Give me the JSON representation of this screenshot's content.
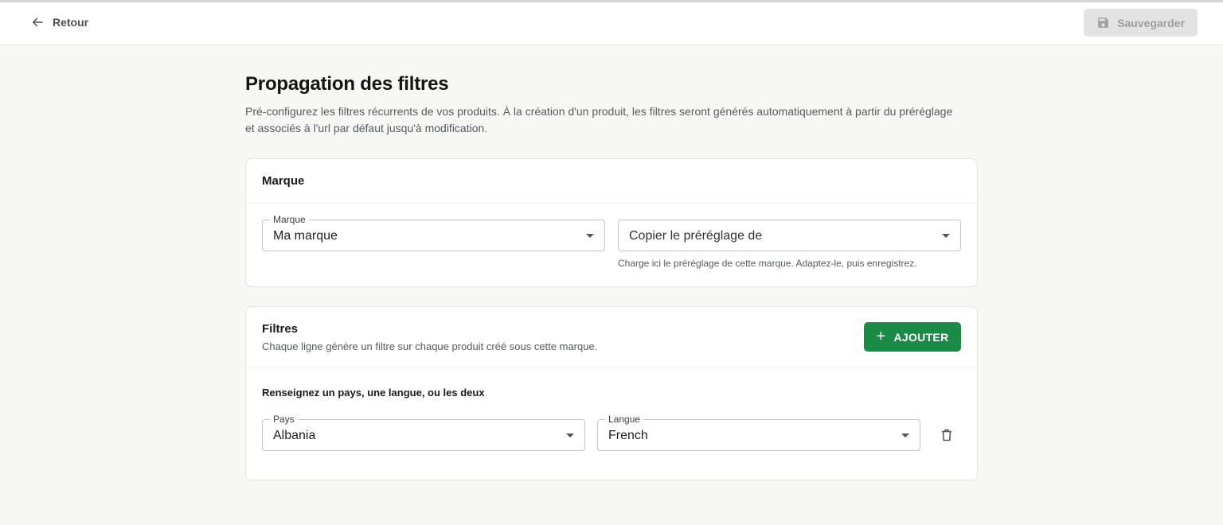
{
  "topbar": {
    "back_label": "Retour",
    "back_icon": "arrow-left-icon",
    "save_label": "Sauvegarder",
    "save_icon": "floppy-disk-icon"
  },
  "page": {
    "title": "Propagation des filtres",
    "description": "Pré-configurez les filtres récurrents de vos produits. À la création d'un produit, les filtres seront générés automatiquement à partir du préréglage et associés à l'url par défaut jusqu'à modification."
  },
  "marque_card": {
    "title": "Marque",
    "brand_field": {
      "label": "Marque",
      "value": "Ma marque"
    },
    "copy_field": {
      "placeholder": "Copier le préréglage de",
      "helper": "Charge ici le préréglage de cette marque. Adaptez-le, puis enregistrez."
    }
  },
  "filtres_card": {
    "title": "Filtres",
    "subtitle": "Chaque ligne génère un filtre sur chaque produit créé sous cette marque.",
    "add_label": "AJOUTER",
    "add_icon": "plus-icon",
    "row_instruction": "Renseignez un pays, une langue, ou les deux",
    "rows": [
      {
        "country_label": "Pays",
        "country_value": "Albania",
        "language_label": "Langue",
        "language_value": "French",
        "delete_icon": "trash-icon"
      }
    ]
  },
  "colors": {
    "background": "#f7f7f3",
    "accent_green": "#1a8a47",
    "disabled_button": "#e3e3e3"
  }
}
